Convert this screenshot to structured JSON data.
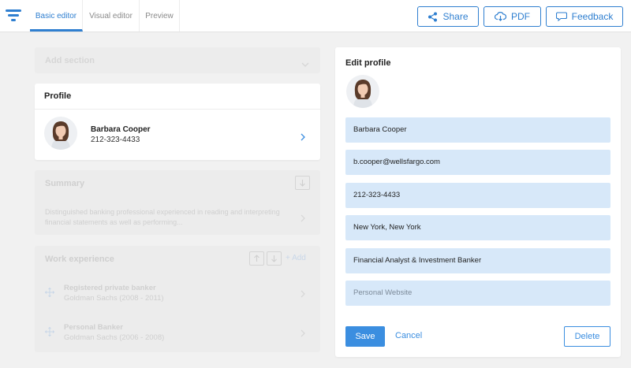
{
  "tabs": [
    {
      "label": "Basic editor"
    },
    {
      "label": "Visual editor"
    },
    {
      "label": "Preview"
    }
  ],
  "toolbar": {
    "share_label": "Share",
    "pdf_label": "PDF",
    "feedback_label": "Feedback"
  },
  "left": {
    "add_section_label": "Add section",
    "profile": {
      "title": "Profile",
      "name": "Barbara Cooper",
      "phone": "212-323-4433"
    },
    "summary": {
      "title": "Summary",
      "text": "Distinguished banking professional experienced in reading and interpreting financial statements as well as performing..."
    },
    "work": {
      "title": "Work experience",
      "add_label": "+ Add",
      "jobs": [
        {
          "title": "Registered private banker",
          "subtitle": "Goldman Sachs (2008 - 2011)"
        },
        {
          "title": "Personal Banker",
          "subtitle": "Goldman Sachs (2006 - 2008)"
        }
      ]
    }
  },
  "edit": {
    "title": "Edit profile",
    "fields": {
      "name": "Barbara Cooper",
      "email": "b.cooper@wellsfargo.com",
      "phone": "212-323-4433",
      "location": "New York, New York",
      "job_title": "Financial Analyst & Investment Banker",
      "website_placeholder": "Personal Website"
    },
    "save_label": "Save",
    "cancel_label": "Cancel",
    "delete_label": "Delete"
  },
  "colors": {
    "accent": "#2f7fd0",
    "field_bg": "#d7e8f9",
    "page_bg": "#f1f1f1"
  }
}
